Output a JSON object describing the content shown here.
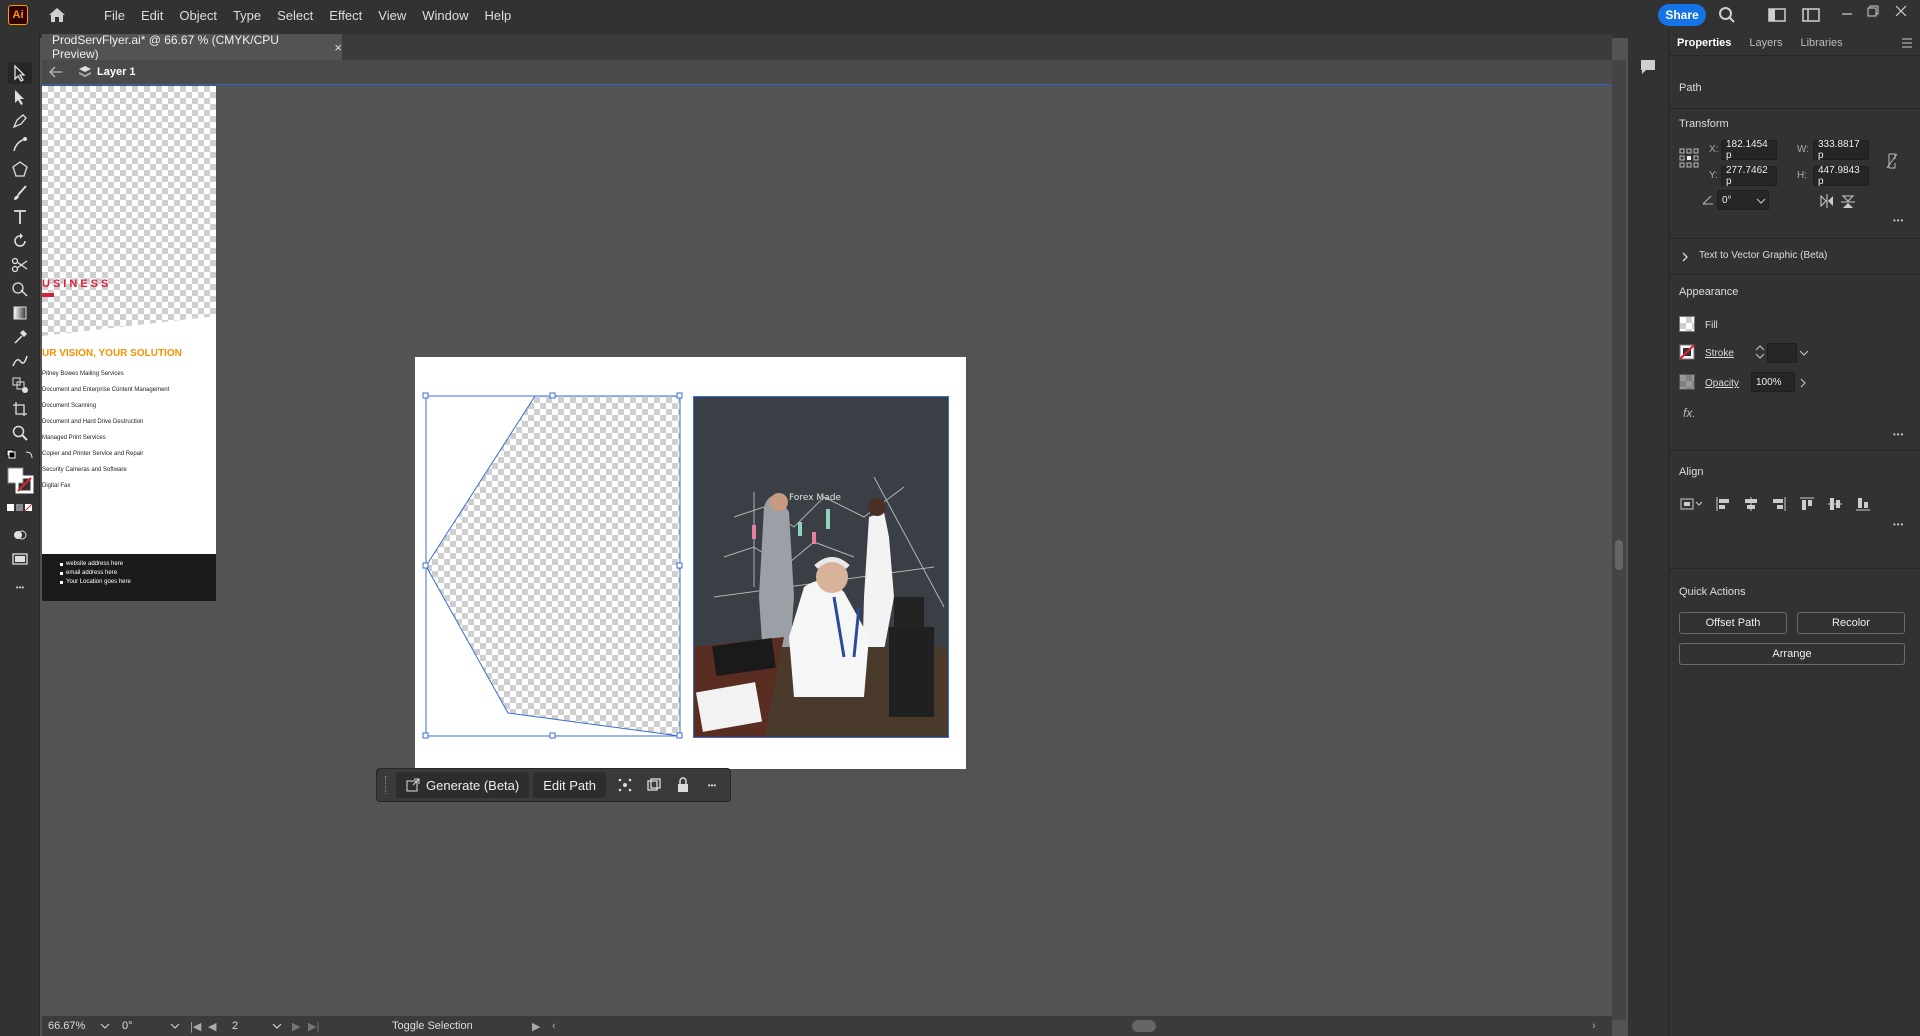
{
  "app": {
    "logo": "Ai",
    "menu": [
      "File",
      "Edit",
      "Object",
      "Type",
      "Select",
      "Effect",
      "View",
      "Window",
      "Help"
    ],
    "share_label": "Share"
  },
  "document": {
    "tab_title": "ProdServFlyer.ai* @ 66.67 % (CMYK/CPU Preview)",
    "close_glyph": "×",
    "layer_name": "Layer 1"
  },
  "flyer": {
    "business_text": "USINESS",
    "headline": "UR VISION, YOUR SOLUTION",
    "services": [
      "Pitney Bowes Mailing Services",
      "Document and Enterprise Content Management",
      "Document Scanning",
      "Document and Hard Drive Destruction",
      "Managed Print Services",
      "Copier and Printer Service and Repair",
      "Security Cameras and Software",
      "Digital Fax"
    ],
    "footer": [
      "website address here",
      "email address here",
      "Your Location goes here"
    ]
  },
  "photo": {
    "chalkboard_text": "Forex Made"
  },
  "context_bar": {
    "generate_label": "Generate (Beta)",
    "edit_path_label": "Edit Path",
    "more_glyph": "•••"
  },
  "status": {
    "zoom": "66.67%",
    "rotation": "0°",
    "artboard": "2",
    "mode": "Toggle Selection"
  },
  "panel": {
    "tabs": [
      "Properties",
      "Layers",
      "Libraries"
    ],
    "object_type": "Path",
    "transform": {
      "title": "Transform",
      "x_label": "X:",
      "x": "182.1454 p",
      "y_label": "Y:",
      "y": "277.7462 p",
      "w_label": "W:",
      "w": "333.8817 p",
      "h_label": "H:",
      "h": "447.9843 p",
      "angle": "0°"
    },
    "text_to_vector": "Text to Vector Graphic (Beta)",
    "appearance": {
      "title": "Appearance",
      "fill": "Fill",
      "stroke": "Stroke",
      "opacity_label": "Opacity",
      "opacity": "100%",
      "fx": "fx."
    },
    "align_title": "Align",
    "quick_actions": {
      "title": "Quick Actions",
      "offset_path": "Offset Path",
      "recolor": "Recolor",
      "arrange": "Arrange"
    },
    "more_glyph": "•••"
  },
  "colors": {
    "accent": "#1473e6",
    "selection": "#3a6ed8",
    "brand_red": "#d81e3a",
    "brand_orange": "#f39200"
  }
}
